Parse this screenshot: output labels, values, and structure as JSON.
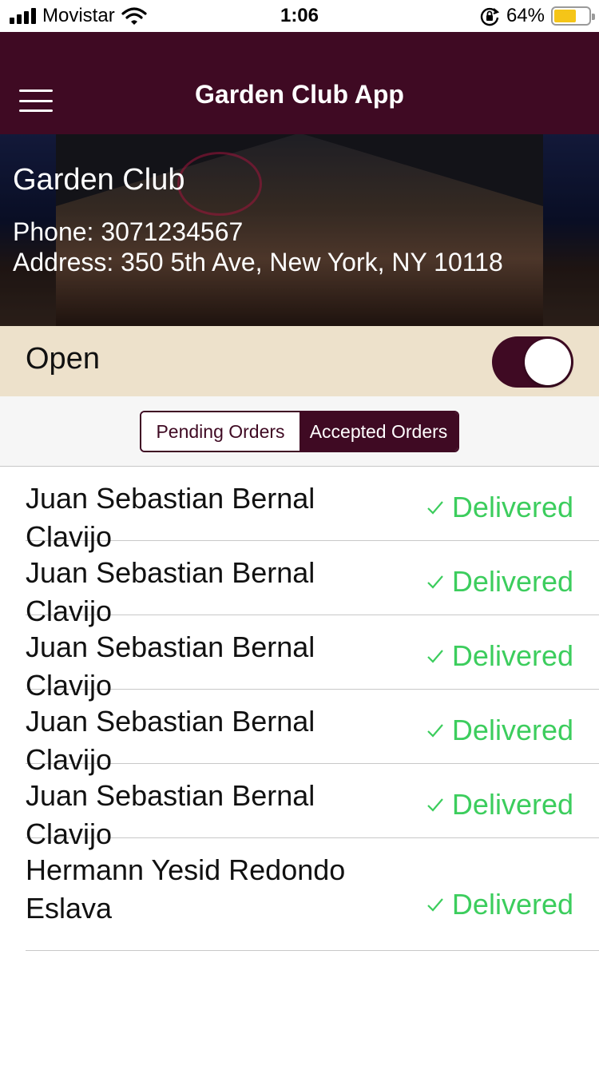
{
  "status_bar": {
    "carrier": "Movistar",
    "time": "1:06",
    "battery_percent": "64%",
    "battery_level": 0.64,
    "icons": [
      "signal-icon",
      "wifi-icon",
      "rotation-lock-icon",
      "battery-icon"
    ]
  },
  "nav": {
    "title": "Garden Club App",
    "menu_icon": "hamburger-menu-icon"
  },
  "venue": {
    "name": "Garden Club",
    "phone": "Phone: 3071234567",
    "address": "Address: 350 5th Ave, New York, NY 10118"
  },
  "open_toggle": {
    "label": "Open",
    "on": true
  },
  "tabs": {
    "pending": "Pending Orders",
    "accepted": "Accepted Orders",
    "selected": "accepted"
  },
  "orders": [
    {
      "name": "Juan Sebastian Bernal Clavijo",
      "status": "Delivered"
    },
    {
      "name": "Juan Sebastian Bernal Clavijo",
      "status": "Delivered"
    },
    {
      "name": "Juan Sebastian Bernal Clavijo",
      "status": "Delivered"
    },
    {
      "name": "Juan Sebastian Bernal Clavijo",
      "status": "Delivered"
    },
    {
      "name": "Juan Sebastian Bernal Clavijo",
      "status": "Delivered"
    },
    {
      "name": "Hermann Yesid Redondo Eslava",
      "status": "Delivered"
    }
  ],
  "colors": {
    "brand": "#3f0a23",
    "open_row_bg": "#ede1cb",
    "delivered": "#3ccd5d"
  }
}
